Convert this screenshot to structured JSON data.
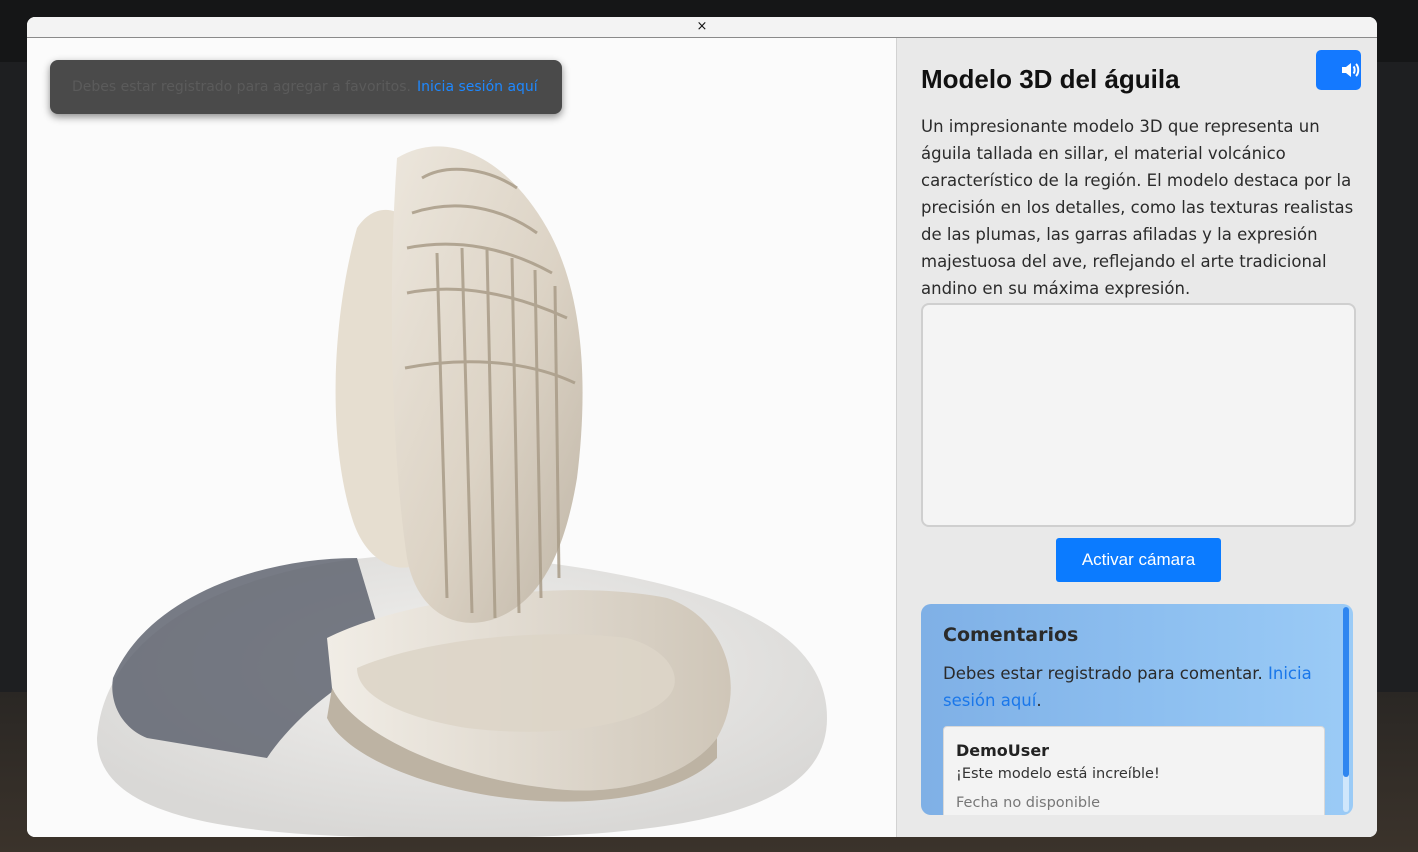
{
  "modal": {
    "close_label": "×"
  },
  "toast": {
    "message": "Debes estar registrado para agregar a favoritos.",
    "link": "Inicia sesión aquí"
  },
  "viewer": {
    "subject": "3D model of a carved stone eagle (sillar)"
  },
  "panel": {
    "audio_icon": "speaker-icon",
    "title": "Modelo 3D del águila",
    "description": "Un impresionante modelo 3D que representa un águila tallada en sillar, el material volcánico característico de la región. El modelo destaca por la precisión en los detalles, como las texturas realistas de las plumas, las garras afiladas y la expresión majestuosa del ave, reflejando el arte tradicional andino en su máxima expresión.",
    "camera_button": "Activar cámara"
  },
  "comments": {
    "title": "Comentarios",
    "note_prefix": "Debes estar registrado para comentar. ",
    "note_link": "Inicia sesión aquí",
    "note_suffix": ".",
    "items": [
      {
        "user": "DemoUser",
        "text": "¡Este modelo está increíble!",
        "date": "Fecha no disponible"
      }
    ]
  },
  "colors": {
    "accent": "#0b7bff",
    "link": "#1e88ff",
    "toast_bg": "#4a4a4a",
    "panel_bg": "#e9e9e9"
  }
}
